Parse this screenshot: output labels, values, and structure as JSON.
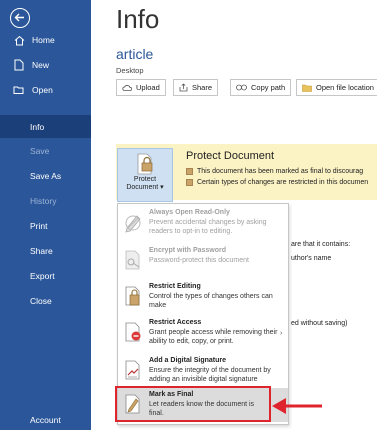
{
  "sidebar": {
    "items": [
      {
        "label": "Home",
        "icon": "home-icon"
      },
      {
        "label": "New",
        "icon": "new-document-icon"
      },
      {
        "label": "Open",
        "icon": "folder-open-icon"
      },
      {
        "label": "Info"
      },
      {
        "label": "Save"
      },
      {
        "label": "Save As"
      },
      {
        "label": "History"
      },
      {
        "label": "Print"
      },
      {
        "label": "Share"
      },
      {
        "label": "Export"
      },
      {
        "label": "Close"
      },
      {
        "label": "Account"
      }
    ]
  },
  "main": {
    "title": "Info",
    "doc_name": "article",
    "doc_location": "Desktop",
    "toolbar": {
      "upload": "Upload",
      "share": "Share",
      "copy_path": "Copy path",
      "open_location": "Open file location"
    },
    "protect": {
      "button_line1": "Protect",
      "button_line2": "Document",
      "caret": "▾",
      "title": "Protect Document",
      "line1": "This document has been marked as final to discourag",
      "line2": "Certain types of changes are restricted in this documen"
    },
    "background": {
      "inspect": "are that it contains:",
      "author": "uthor's name",
      "versions": "ed without saving)"
    }
  },
  "menu": {
    "items": [
      {
        "title": "Always Open Read-Only",
        "desc": "Prevent accidental changes by asking readers to opt-in to editing.",
        "icon": "pencil-disabled-icon"
      },
      {
        "title": "Encrypt with Password",
        "desc": "Password-protect this document",
        "icon": "key-lock-icon"
      },
      {
        "title": "Restrict Editing",
        "desc": "Control the types of changes others can make",
        "icon": "restrict-editing-icon"
      },
      {
        "title": "Restrict Access",
        "desc": "Grant people access while removing their ability to edit, copy, or print.",
        "icon": "restrict-access-icon"
      },
      {
        "title": "Add a Digital Signature",
        "desc": "Ensure the integrity of the document by adding an invisible digital signature",
        "icon": "digital-signature-icon"
      },
      {
        "title": "Mark as Final",
        "desc": "Let readers know the document is final.",
        "icon": "mark-as-final-icon"
      }
    ]
  },
  "colors": {
    "sidebar": "#2b579a",
    "accent": "#2b579a",
    "highlight_box": "#e0242e",
    "protect_bg": "#fcf3c5"
  }
}
